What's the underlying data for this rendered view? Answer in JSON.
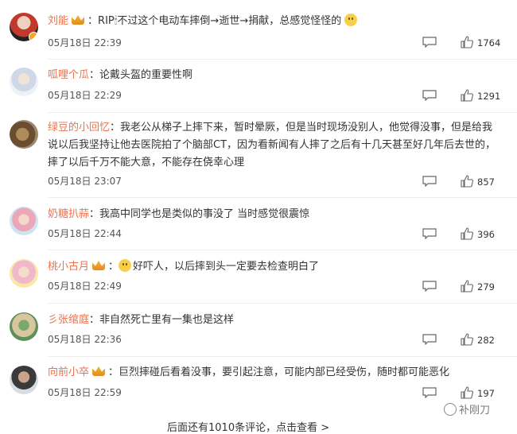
{
  "comments": [
    {
      "name": "刘能",
      "has_crown": true,
      "has_verified": true,
      "text": "RIP🕯不过这个电动车摔倒→逝世→捐献，总感觉怪怪的",
      "trailing_emoji": "smile-emoji",
      "date": "05月18日 22:39",
      "likes": "1764"
    },
    {
      "name": "呱哩个瓜",
      "has_crown": false,
      "text": "论戴头盔的重要性啊",
      "date": "05月18日 22:29",
      "likes": "1291"
    },
    {
      "name": "绿豆的小回忆",
      "has_crown": false,
      "text": "我老公从梯子上摔下来，暂时晕厥，但是当时现场没别人，他觉得没事，但是给我说以后我坚持让他去医院拍了个脑部CT，因为看新闻有人摔了之后有十几天甚至好几年后去世的，摔了以后千万不能大意，不能存在侥幸心理",
      "date": "05月18日 23:07",
      "likes": "857"
    },
    {
      "name": "奶糖扒蒜",
      "has_crown": false,
      "text": "我高中同学也是类似的事没了 当时感觉很震惊",
      "date": "05月18日 22:44",
      "likes": "396"
    },
    {
      "name": "桃小古月",
      "has_crown": true,
      "leading_emoji": "smile-emoji",
      "text": "好吓人，以后摔到头一定要去检查明白了",
      "date": "05月18日 22:49",
      "likes": "279"
    },
    {
      "name": "彡张绾庭",
      "has_crown": false,
      "text": "非自然死亡里有一集也是这样",
      "date": "05月18日 22:36",
      "likes": "282"
    },
    {
      "name": "向前小卒",
      "has_crown": true,
      "text": "巨烈摔碰后看着没事，要引起注意，可能内部已经受伤，随时都可能恶化",
      "date": "05月18日 22:59",
      "likes": "197"
    }
  ],
  "footer": {
    "more_text": "后面还有1010条评论，点击查看 >"
  },
  "watermark": {
    "text": "补刚刀"
  }
}
